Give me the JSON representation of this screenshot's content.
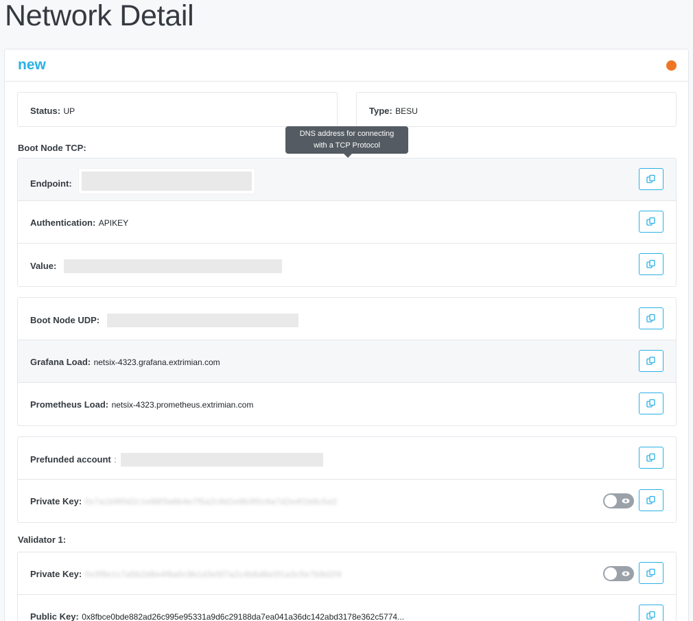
{
  "page": {
    "title": "Network Detail"
  },
  "network": {
    "name": "new",
    "status_color": "#f07625"
  },
  "status": {
    "label": "Status:",
    "value": "UP"
  },
  "type": {
    "label": "Type:",
    "value": "BESU"
  },
  "boot_node_tcp": {
    "section_label": "Boot Node TCP:",
    "tooltip": "DNS address for connecting with a TCP Protocol",
    "endpoint_label": "Endpoint:",
    "authentication_label": "Authentication:",
    "authentication_value": "APIKEY",
    "value_label": "Value:"
  },
  "network_group": {
    "boot_node_udp_label": "Boot Node UDP:",
    "grafana_label": "Grafana Load:",
    "grafana_value": "netsix-4323.grafana.extrimian.com",
    "prometheus_label": "Prometheus Load:",
    "prometheus_value": "netsix-4323.prometheus.extrimian.com"
  },
  "prefunded": {
    "account_label": "Prefunded account",
    "account_sep": ":",
    "private_key_label": "Private Key:",
    "private_key_masked": "0x7a1b9f0d2c1e88f3a6b4e7f5a2c8d1e9b3f0c6a7d2e4f1b8c5a3"
  },
  "validator1": {
    "section_label": "Validator 1:",
    "private_key_label": "Private Key:",
    "private_key_masked": "0x3f9e1c7a5b2d8e4f6a0c9b1d3e5f7a2c4b6d8e0f1a3c5e7b9d2f4",
    "public_key_label": "Public Key:",
    "public_key_value": "0x8fbce0bde882ad26c995e95331a9d6c29188da7ea041a36dc142abd3178e362c5774..."
  },
  "colors": {
    "accent": "#29b0e6",
    "status_dot": "#f07625",
    "toggle": "#9aa1a8"
  },
  "icons": {
    "copy": "copy-icon",
    "eye": "eye-icon"
  }
}
